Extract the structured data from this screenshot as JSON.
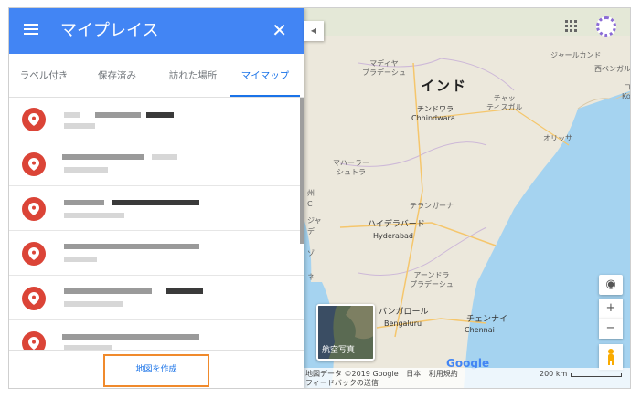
{
  "panel": {
    "title": "マイプレイス",
    "close_icon": "✕",
    "tabs": [
      {
        "label": "ラベル付き",
        "active": false
      },
      {
        "label": "保存済み",
        "active": false
      },
      {
        "label": "訪れた場所",
        "active": false
      },
      {
        "label": "マイマップ",
        "active": true
      }
    ],
    "create_map_label": "地図を作成"
  },
  "colors": {
    "header_blue": "#4285f4",
    "active_tab": "#1a73e8",
    "pin_red": "#db4437",
    "highlight_orange": "#f08a2c"
  },
  "map": {
    "labels": {
      "india": "インド",
      "madhya_pradesh": "マディヤ\nプラデーシュ",
      "chhindwara_ja": "チンドワラ",
      "chhindwara_en": "Chhindwara",
      "chhattisgarh": "チャッ\nティスガル",
      "maharashtra": "マハーラー\nシュトラ",
      "odisha": "オリッサ",
      "jharkhand": "ジャールカンド",
      "west_bengal": "西ベンガル",
      "telangana": "テランガーナ",
      "hyderabad_ja": "ハイデラバード",
      "hyderabad_en": "Hyderabad",
      "andhra_pradesh": "アーンドラ\nプラデーシュ",
      "bangalore_ja": "バンガロール",
      "bengaluru_en": "Bengaluru",
      "chennai_ja": "チェンナイ",
      "chennai_en": "Chennai",
      "kolkata_ja": "コ",
      "kolkata_en": "Ko",
      "partial_state": "州",
      "partial_c": "C",
      "partial_jiang": "ジャ",
      "partial_de": "デ",
      "partial_zo": "ゾ",
      "partial_ne": "ネ"
    },
    "satellite_label": "航空写真",
    "google_logo": "Google",
    "attribution": {
      "map_data": "地図データ ©2019 Google",
      "country": "日本",
      "terms": "利用規約",
      "feedback": "フィードバックの送信"
    },
    "scale": "200 km",
    "zoom_in": "+",
    "zoom_out": "−"
  }
}
